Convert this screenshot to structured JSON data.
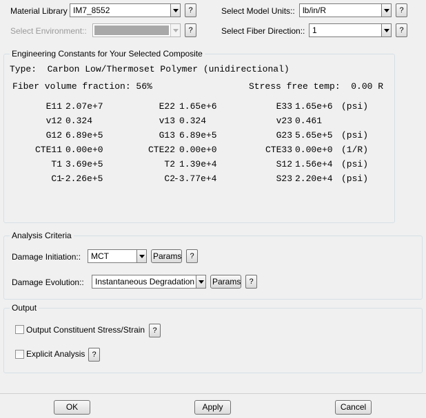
{
  "top": {
    "material_library_label": "Material Library",
    "material_library_value": "IM7_8552",
    "environment_label": "Select Environment::",
    "model_units_label": "Select Model Units::",
    "model_units_value": "lb/in/R",
    "fiber_direction_label": "Select Fiber Direction::",
    "fiber_direction_value": "1",
    "help_label": "?"
  },
  "constants": {
    "legend": "Engineering Constants for Your Selected Composite",
    "type_line": "Type:  Carbon Low/Thermoset Polymer (unidirectional)",
    "fiber_volume": "Fiber volume fraction: 56%",
    "stress_free": "Stress free temp:  0.00 R",
    "rows": [
      {
        "n1": "E11",
        "v1": "2.07e+7",
        "n2": "E22",
        "v2": "1.65e+6",
        "n3": "E33",
        "v3": "1.65e+6",
        "unit": "(psi)"
      },
      {
        "n1": "v12",
        "v1": "0.324",
        "n2": "v13",
        "v2": "0.324",
        "n3": "v23",
        "v3": "0.461",
        "unit": ""
      },
      {
        "n1": "G12",
        "v1": "6.89e+5",
        "n2": "G13",
        "v2": "6.89e+5",
        "n3": "G23",
        "v3": "5.65e+5",
        "unit": "(psi)"
      },
      {
        "n1": "CTE11",
        "v1": "0.00e+0",
        "n2": "CTE22",
        "v2": "0.00e+0",
        "n3": "CTE33",
        "v3": "0.00e+0",
        "unit": "(1/R)"
      },
      {
        "n1": "T1",
        "v1": "3.69e+5",
        "n2": "T2",
        "v2": "1.39e+4",
        "n3": "S12",
        "v3": "1.56e+4",
        "unit": "(psi)"
      },
      {
        "n1": "C1",
        "v1": "-2.26e+5",
        "n2": "C2",
        "v2": "-3.77e+4",
        "n3": "S23",
        "v3": "2.20e+4",
        "unit": "(psi)"
      }
    ]
  },
  "analysis": {
    "legend": "Analysis Criteria",
    "damage_init_label": "Damage Initiation::",
    "damage_init_value": "MCT",
    "damage_evo_label": "Damage Evolution::",
    "damage_evo_value": "Instantaneous Degradation",
    "params_label": "Params"
  },
  "output": {
    "legend": "Output",
    "constituent_label": "Output Constituent Stress/Strain",
    "explicit_label": "Explicit Analysis"
  },
  "footer": {
    "ok_label": "OK",
    "apply_label": "Apply",
    "cancel_label": "Cancel"
  }
}
